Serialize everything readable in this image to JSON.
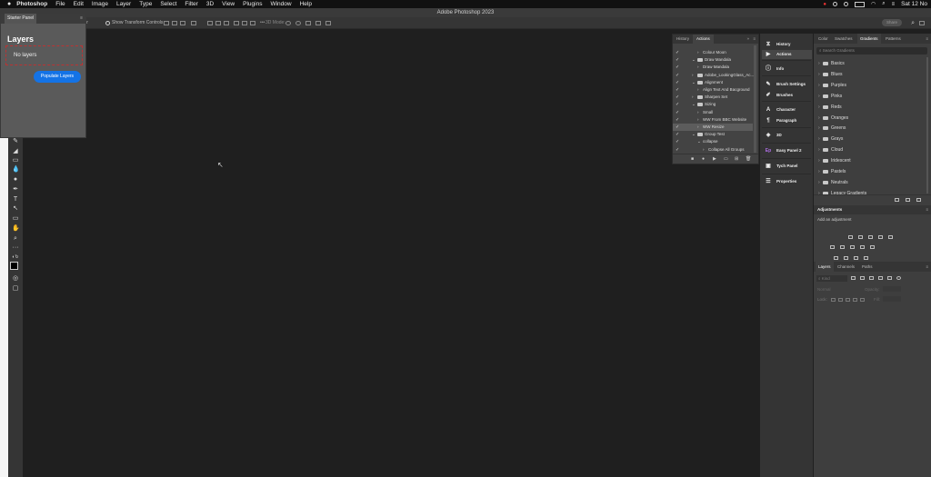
{
  "menubar": {
    "apple": "",
    "app": "Photoshop",
    "items": [
      "File",
      "Edit",
      "Image",
      "Layer",
      "Type",
      "Select",
      "Filter",
      "3D",
      "View",
      "Plugins",
      "Window",
      "Help"
    ],
    "clock": "Sat 12 No"
  },
  "titlebar": {
    "title": "Adobe Photoshop 2023"
  },
  "options": {
    "layer_label": "yer",
    "show_transform": "Show Transform Controls",
    "mode_3d": "3D Mode:",
    "share": "Share"
  },
  "starter": {
    "tab": "Starter Panel",
    "heading": "Layers",
    "no_layers": "No layers",
    "populate": "Populate Layers"
  },
  "actions_panel": {
    "tabs": [
      "History",
      "Actions"
    ],
    "rows": [
      {
        "label": "Colour Moon",
        "indent": 1,
        "folder": false,
        "expanded": false,
        "checked": true
      },
      {
        "label": "Draw Mandala",
        "indent": 0,
        "folder": true,
        "expanded": true,
        "checked": true
      },
      {
        "label": "Draw Mandala",
        "indent": 1,
        "folder": false,
        "expanded": false,
        "checked": true
      },
      {
        "label": "Adobe_LookingGlass_Ac...",
        "indent": 0,
        "folder": true,
        "expanded": false,
        "checked": true
      },
      {
        "label": "Alignment",
        "indent": 0,
        "folder": true,
        "expanded": true,
        "checked": true
      },
      {
        "label": "Align Text And Bacground",
        "indent": 1,
        "folder": false,
        "expanded": false,
        "checked": true
      },
      {
        "label": "Sharpen Set",
        "indent": 0,
        "folder": true,
        "expanded": false,
        "checked": true
      },
      {
        "label": "Sizing",
        "indent": 0,
        "folder": true,
        "expanded": true,
        "checked": true
      },
      {
        "label": "Small",
        "indent": 1,
        "folder": false,
        "expanded": false,
        "checked": true
      },
      {
        "label": "WW From BBC Website",
        "indent": 1,
        "folder": false,
        "expanded": false,
        "checked": true
      },
      {
        "label": "WW Resize",
        "indent": 1,
        "folder": false,
        "expanded": false,
        "checked": true,
        "selected": true
      },
      {
        "label": "Group Test",
        "indent": 0,
        "folder": true,
        "expanded": true,
        "checked": true
      },
      {
        "label": "collapse",
        "indent": 1,
        "folder": false,
        "expanded": true,
        "checked": true
      },
      {
        "label": "Collapse All Groups",
        "indent": 2,
        "folder": false,
        "expanded": false,
        "checked": true
      }
    ]
  },
  "dock": [
    {
      "icon": "history-icon",
      "glyph": "⧖",
      "label": "History"
    },
    {
      "icon": "play-icon",
      "glyph": "▶",
      "label": "Actions",
      "selected": true
    },
    {
      "icon": "info-icon",
      "glyph": "ⓘ",
      "label": "Info"
    },
    {
      "icon": "brush-settings-icon",
      "glyph": "✎",
      "label": "Brush Settings"
    },
    {
      "icon": "brushes-icon",
      "glyph": "✐",
      "label": "Brushes"
    },
    {
      "icon": "character-icon",
      "glyph": "A",
      "label": "Character"
    },
    {
      "icon": "paragraph-icon",
      "glyph": "¶",
      "label": "Paragraph"
    },
    {
      "icon": "3d-icon",
      "glyph": "◈",
      "label": "3D"
    },
    {
      "icon": "easy-panel-icon",
      "glyph": "Ep",
      "label": "Easy Panel 2"
    },
    {
      "icon": "tych-panel-icon",
      "glyph": "▣",
      "label": "Tych Panel"
    },
    {
      "icon": "properties-icon",
      "glyph": "☰",
      "label": "Properties"
    }
  ],
  "gradients_panel": {
    "tabs": [
      "Color",
      "Swatches",
      "Gradients",
      "Patterns"
    ],
    "search_placeholder": "Search Gradients",
    "folders": [
      "Basics",
      "Blues",
      "Purples",
      "Pinks",
      "Reds",
      "Oranges",
      "Greens",
      "Grays",
      "Cloud",
      "Iridescent",
      "Pastels",
      "Neutrals",
      "Legacy Gradients"
    ]
  },
  "adjustments_panel": {
    "title": "Adjustments",
    "add_label": "Add an adjustment"
  },
  "layers_panel": {
    "tabs": [
      "Layers",
      "Channels",
      "Paths"
    ],
    "kind": "Kind",
    "blend": "Normal",
    "opacity_label": "Opacity:",
    "lock_label": "Lock:",
    "fill_label": "Fill:"
  }
}
